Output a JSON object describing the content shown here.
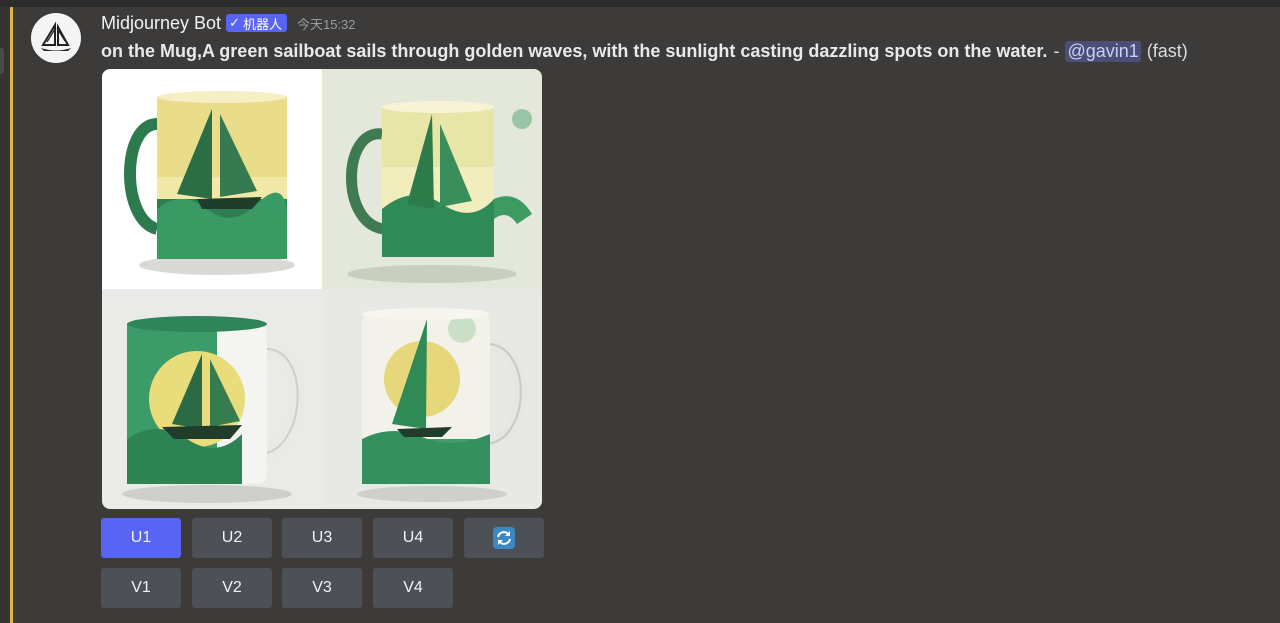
{
  "author": {
    "name": "Midjourney Bot",
    "badge": "机器人",
    "timestamp": "今天15:32",
    "avatar_icon": "sailboat-icon"
  },
  "message": {
    "prompt": "on the Mug,A green sailboat sails through golden waves, with the sunlight casting dazzling spots on the water.",
    "separator": "-",
    "mention": "@gavin1",
    "speed": "(fast)"
  },
  "image_grid": {
    "description_icons": [
      "mug-sailboat-1",
      "mug-sailboat-2",
      "mug-sailboat-3",
      "mug-sailboat-4"
    ]
  },
  "buttons": {
    "u1": "U1",
    "u2": "U2",
    "u3": "U3",
    "u4": "U4",
    "reroll_icon": "refresh-icon",
    "v1": "V1",
    "v2": "V2",
    "v3": "V3",
    "v4": "V4"
  },
  "colors": {
    "primary_button": "#5865f2",
    "secondary_button": "#4e5058",
    "mention_bar": "#e0b44a",
    "background": "#3d3b39"
  }
}
